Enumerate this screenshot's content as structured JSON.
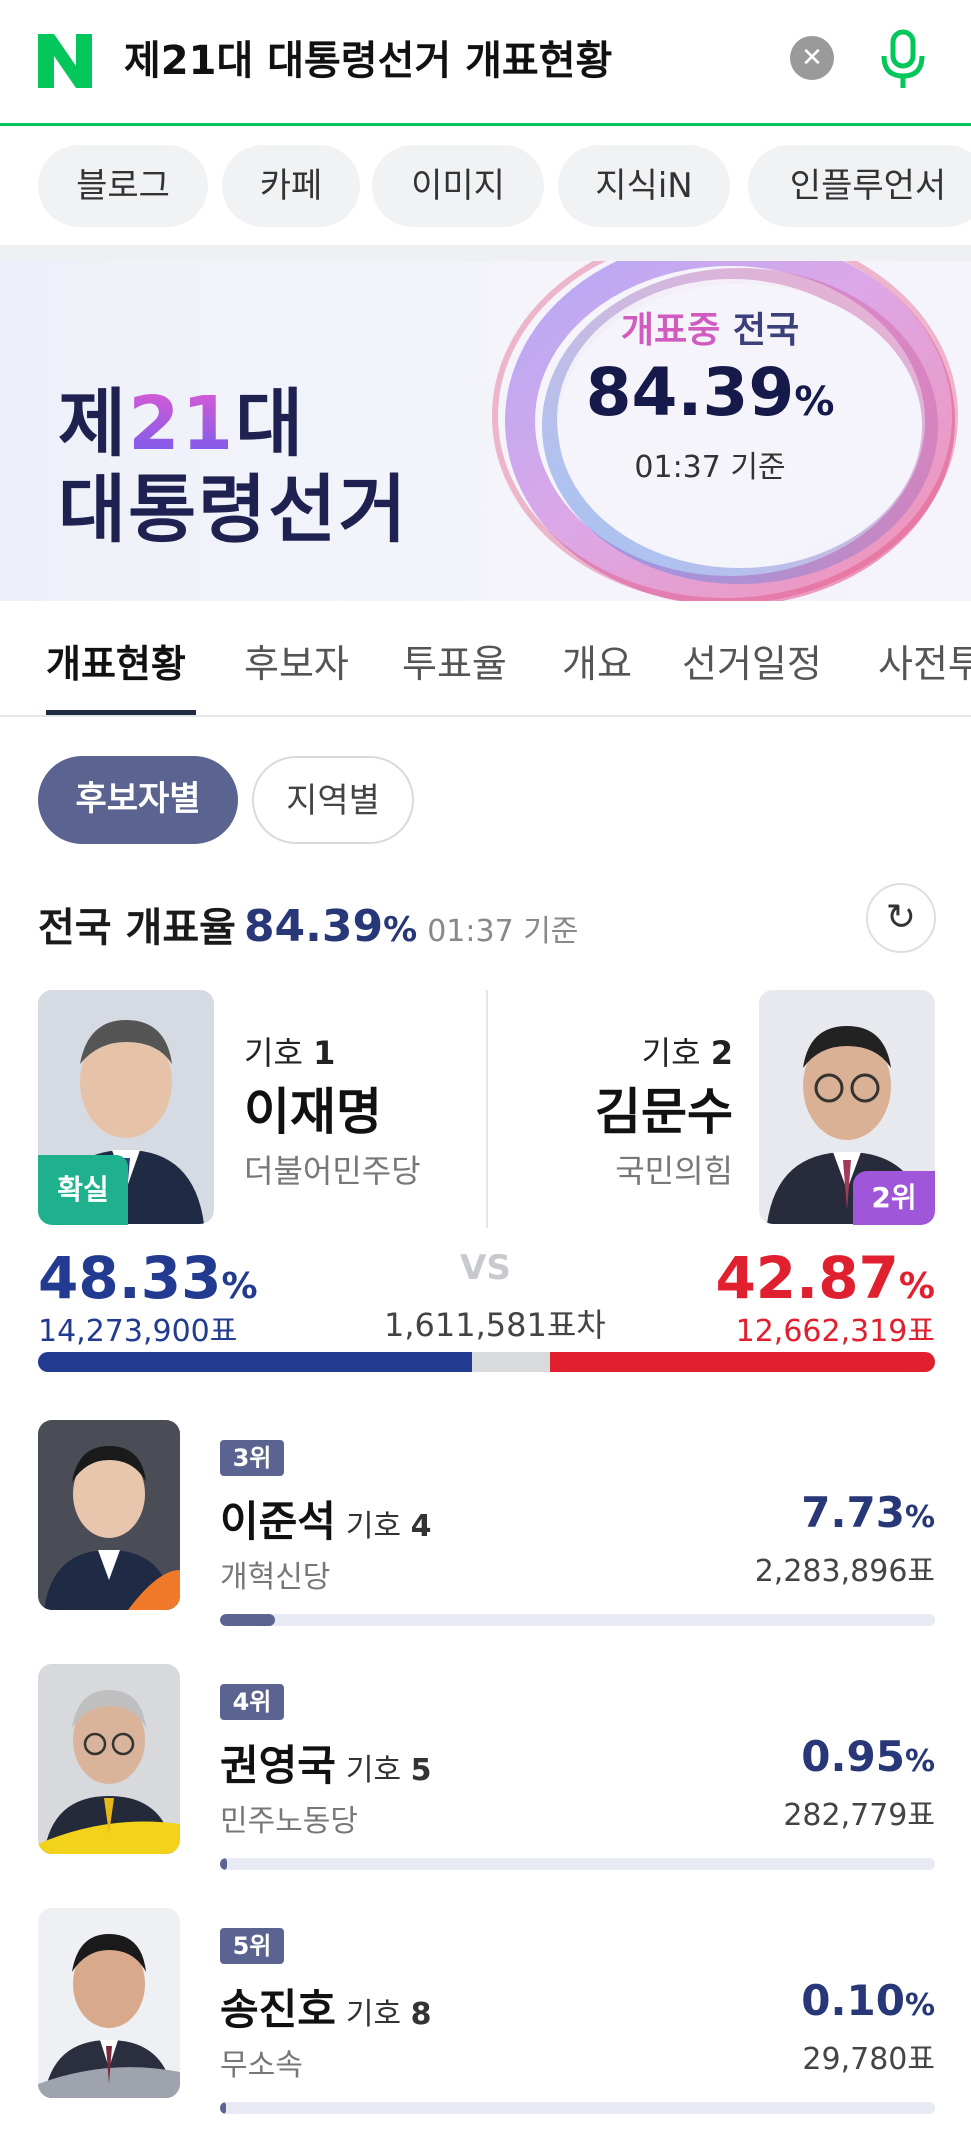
{
  "search": {
    "logo": "N",
    "query": "제21대 대통령선거 개표현황"
  },
  "chips": [
    "블로그",
    "카페",
    "이미지",
    "지식iN",
    "인플루언서"
  ],
  "banner": {
    "title_line1_pre": "제",
    "title_line1_num": "21",
    "title_line1_post": "대",
    "title_line2": "대통령선거",
    "status_pink": "개표중",
    "status_label": "전국",
    "status_value": "84.39",
    "status_pct": "%",
    "status_time": "01:37 기준"
  },
  "tabs": [
    "개표현황",
    "후보자",
    "투표율",
    "개요",
    "선거일정",
    "사전투"
  ],
  "filters": {
    "by_candidate": "후보자별",
    "by_region": "지역별"
  },
  "rate": {
    "label": "전국 개표율",
    "value": "84.39",
    "pct": "%",
    "time": "01:37 기준"
  },
  "leader": {
    "badge": "확실",
    "giho_label": "기호",
    "giho_num": "1",
    "name": "이재명",
    "party": "더불어민주당",
    "pct": "48.33",
    "votes": "14,273,900표",
    "share": 48.33,
    "color": "#233a91"
  },
  "runner_up": {
    "badge": "2위",
    "giho_label": "기호",
    "giho_num": "2",
    "name": "김문수",
    "party": "국민의힘",
    "pct": "42.87",
    "votes": "12,662,319표",
    "share": 42.87,
    "color": "#e0202e"
  },
  "vs": "VS",
  "gap": "1,611,581표차",
  "pct_sign": "%",
  "others": [
    {
      "rank": "3위",
      "name": "이준석",
      "giho_label": "기호",
      "giho_num": "4",
      "party": "개혁신당",
      "pct": "7.73",
      "votes": "2,283,896표",
      "share": 7.73
    },
    {
      "rank": "4위",
      "name": "권영국",
      "giho_label": "기호",
      "giho_num": "5",
      "party": "민주노동당",
      "pct": "0.95",
      "votes": "282,779표",
      "share": 0.95
    },
    {
      "rank": "5위",
      "name": "송진호",
      "giho_label": "기호",
      "giho_num": "8",
      "party": "무소속",
      "pct": "0.10",
      "votes": "29,780표",
      "share": 0.1
    }
  ]
}
